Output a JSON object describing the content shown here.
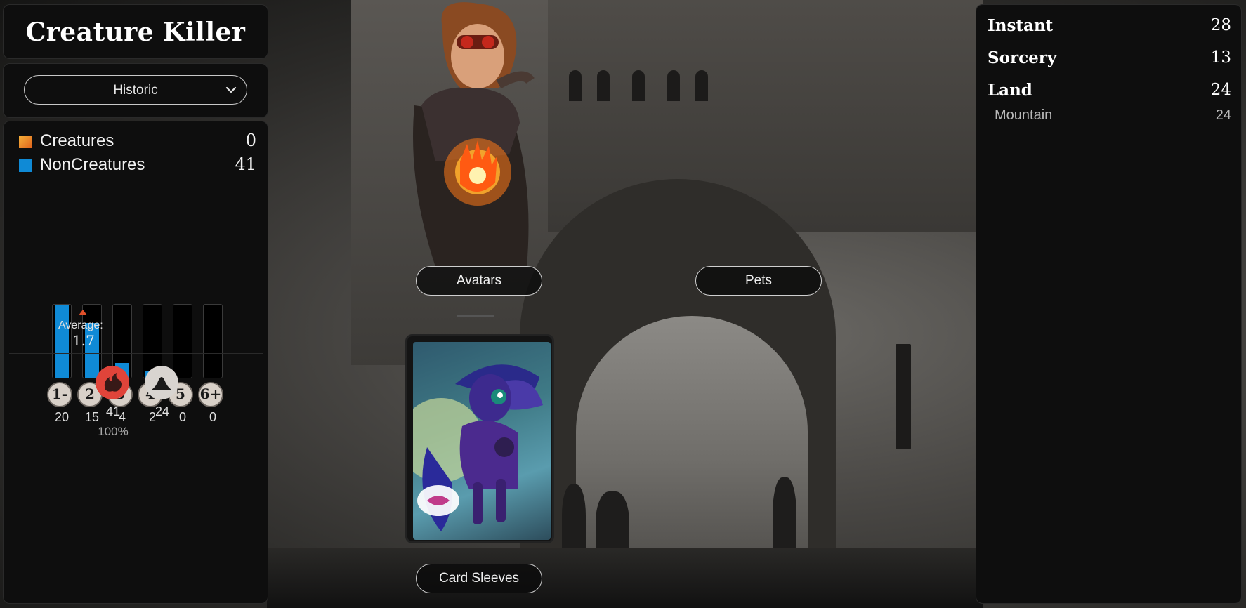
{
  "deck": {
    "title": "Creature Killer"
  },
  "format": {
    "selected": "Historic"
  },
  "stats": {
    "types": [
      {
        "label": "Creatures",
        "count": "0",
        "color": "#f08a1c"
      },
      {
        "label": "NonCreatures",
        "count": "41",
        "color": "#0f8ad6"
      }
    ],
    "curve": [
      {
        "cost": "1-",
        "count": "20",
        "fill": 1.0
      },
      {
        "cost": "2",
        "count": "15",
        "fill": 0.75
      },
      {
        "cost": "3",
        "count": "4",
        "fill": 0.2
      },
      {
        "cost": "4",
        "count": "2",
        "fill": 0.1
      },
      {
        "cost": "5",
        "count": "0",
        "fill": 0
      },
      {
        "cost": "6+",
        "count": "0",
        "fill": 0
      }
    ],
    "average_label": "Average:",
    "average_value": "1.7",
    "mana": [
      {
        "icon": "red-mana-icon",
        "count": "41",
        "percent": "100%",
        "color": "#e0443a"
      },
      {
        "icon": "colorless-mana-icon",
        "count": "24",
        "color": "#d8d4d0"
      }
    ]
  },
  "cosmetics": {
    "avatars_label": "Avatars",
    "pets_label": "Pets",
    "sleeves_label": "Card Sleeves"
  },
  "decklist": {
    "groups": [
      {
        "label": "Instant",
        "count": "28"
      },
      {
        "label": "Sorcery",
        "count": "13"
      },
      {
        "label": "Land",
        "count": "24"
      }
    ],
    "land_subtypes": [
      {
        "label": "Mountain",
        "count": "24"
      }
    ]
  }
}
